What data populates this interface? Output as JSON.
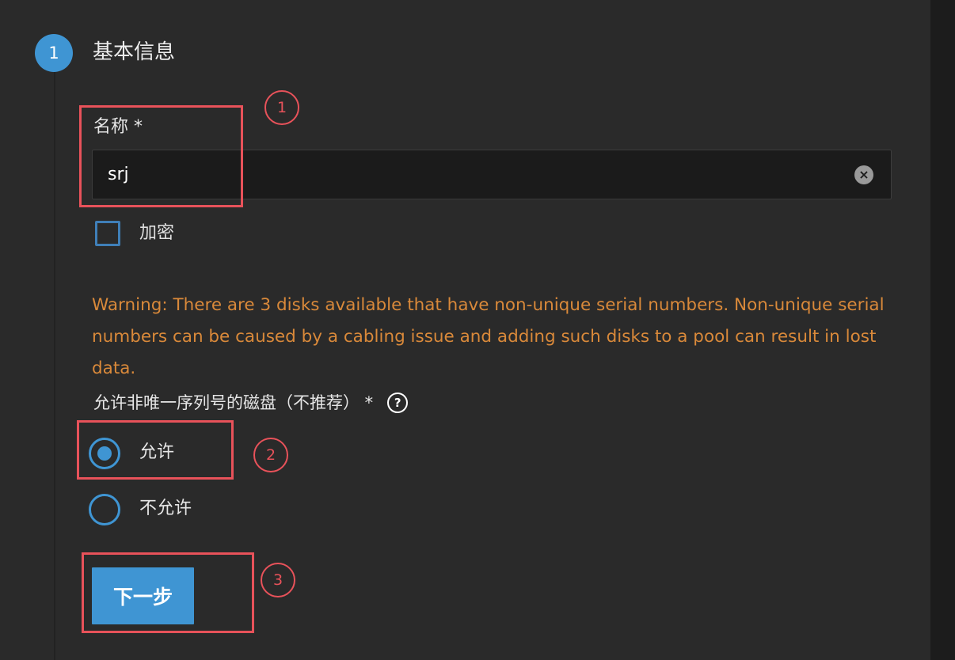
{
  "step": {
    "number": "1",
    "title": "基本信息"
  },
  "name_field": {
    "label": "名称 *",
    "value": "srj",
    "clear_icon": "clear-icon"
  },
  "encryption": {
    "label": "加密",
    "checked": false
  },
  "warning_text": "Warning: There are 3 disks available that have non-unique serial numbers. Non-unique serial numbers can be caused by a cabling issue and adding such disks to a pool can result in lost data.",
  "non_unique_serials": {
    "label": "允许非唯一序列号的磁盘（不推荐） *",
    "help_icon": "question-circle-icon",
    "help_glyph": "?",
    "options": [
      {
        "label": "允许",
        "selected": true
      },
      {
        "label": "不允许",
        "selected": false
      }
    ]
  },
  "next_button": {
    "label": "下一步"
  },
  "annotations": [
    "1",
    "2",
    "3"
  ],
  "colors": {
    "accent": "#3f95d3",
    "warning": "#d9893a",
    "annotation": "#e8525a",
    "panel_bg": "#2a2a2a"
  }
}
